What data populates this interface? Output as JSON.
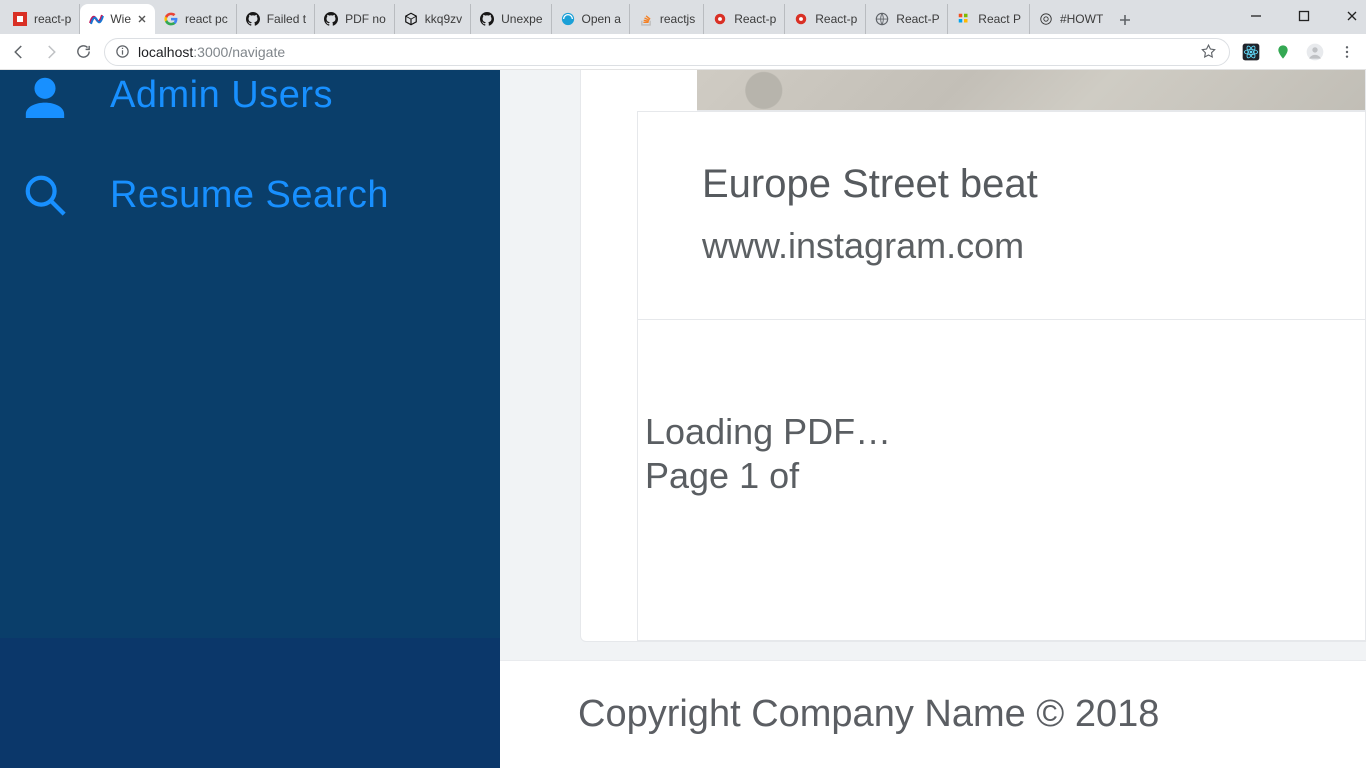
{
  "browser": {
    "tabs": [
      {
        "label": "react-p",
        "favicon": "npm"
      },
      {
        "label": "Wie",
        "favicon": "wojtekma",
        "active": true
      },
      {
        "label": "react pc",
        "favicon": "google"
      },
      {
        "label": "Failed t",
        "favicon": "github"
      },
      {
        "label": "PDF no",
        "favicon": "github"
      },
      {
        "label": "kkq9zv",
        "favicon": "codesandbox"
      },
      {
        "label": "Unexpe",
        "favicon": "github"
      },
      {
        "label": "Open a",
        "favicon": "openany"
      },
      {
        "label": "reactjs",
        "favicon": "stackoverflow"
      },
      {
        "label": "React-p",
        "favicon": "gear-red"
      },
      {
        "label": "React-p",
        "favicon": "gear-red"
      },
      {
        "label": "React-P",
        "favicon": "globe"
      },
      {
        "label": "React P",
        "favicon": "grid"
      },
      {
        "label": "#HOWT",
        "favicon": "riot"
      }
    ],
    "url_host_dim": "localhost",
    "url_host": ":3000",
    "url_path": "/navigate"
  },
  "sidebar": {
    "items": [
      {
        "icon": "user",
        "label": "Admin Users"
      },
      {
        "icon": "search",
        "label": "Resume Search"
      }
    ]
  },
  "card": {
    "title": "Europe Street beat",
    "subtitle": "www.instagram.com",
    "loading_text": "Loading PDF…",
    "page_text": "Page 1 of "
  },
  "footer": {
    "text": "Copyright Company Name © 2018"
  }
}
